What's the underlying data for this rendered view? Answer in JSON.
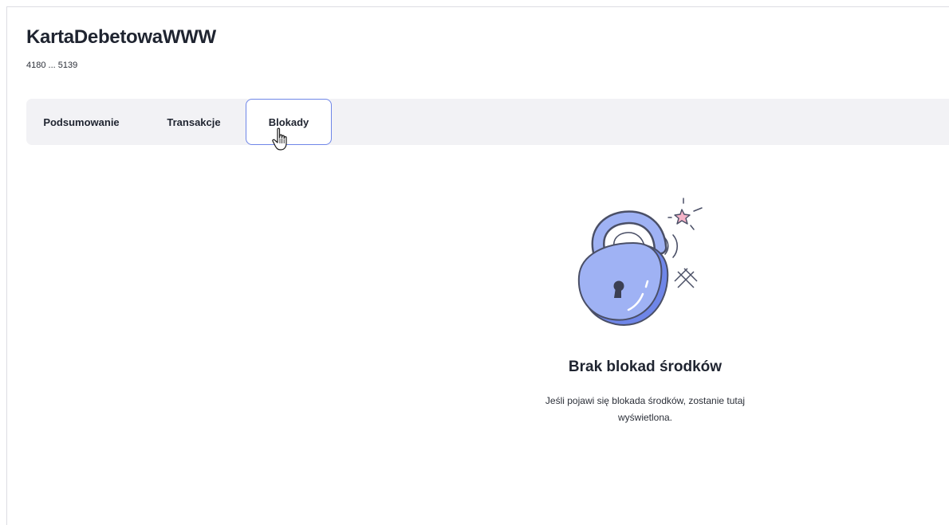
{
  "card": {
    "name": "KartaDebetowaWWW",
    "number": "4180 ... 5139"
  },
  "tabs": [
    {
      "label": "Podsumowanie",
      "active": false
    },
    {
      "label": "Transakcje",
      "active": false
    },
    {
      "label": "Blokady",
      "active": true
    }
  ],
  "empty_state": {
    "illustration": "padlock-icon",
    "title": "Brak blokad środków",
    "description": "Jeśli pojawi się blokada środków, zostanie tutaj wyświetlona."
  },
  "colors": {
    "accent_border": "#6f86e8",
    "tabs_background": "#f2f2f5",
    "lock_body": "#9fb2f4",
    "lock_shadow": "#6f86e8",
    "sparkle_pink": "#f4b4c8"
  }
}
